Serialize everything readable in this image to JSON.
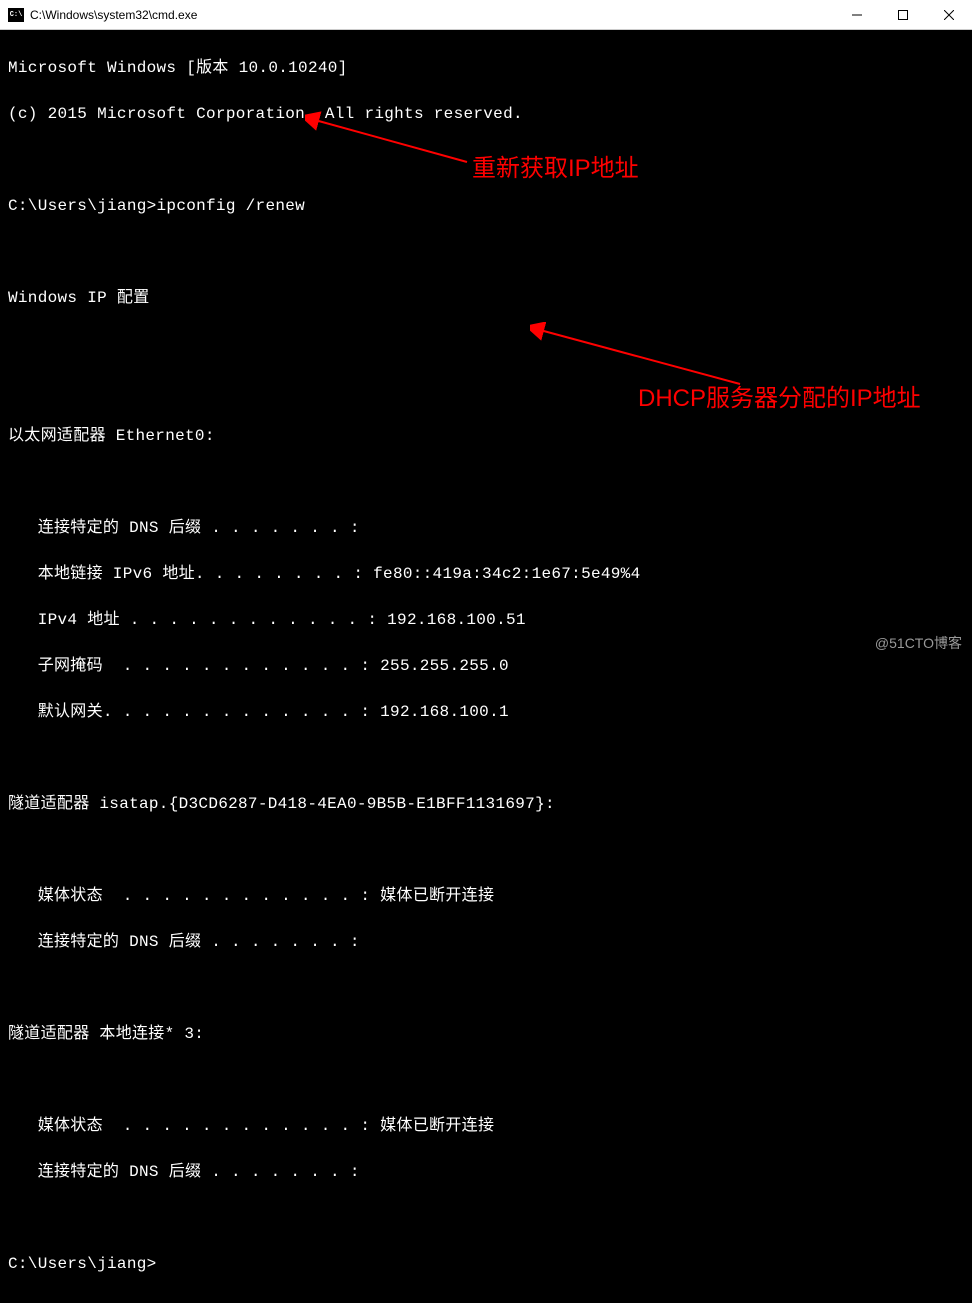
{
  "window": {
    "title": "C:\\Windows\\system32\\cmd.exe"
  },
  "terminal": {
    "line1": "Microsoft Windows [版本 10.0.10240]",
    "line2": "(c) 2015 Microsoft Corporation. All rights reserved.",
    "blank1": "",
    "prompt1": "C:\\Users\\jiang>ipconfig /renew",
    "blank2": "",
    "header1": "Windows IP 配置",
    "blank3": "",
    "blank4": "",
    "adapter1_title": "以太网适配器 Ethernet0:",
    "blank5": "",
    "adapter1_dns": "   连接特定的 DNS 后缀 . . . . . . . :",
    "adapter1_ipv6": "   本地链接 IPv6 地址. . . . . . . . : fe80::419a:34c2:1e67:5e49%4",
    "adapter1_ipv4": "   IPv4 地址 . . . . . . . . . . . . : 192.168.100.51",
    "adapter1_mask": "   子网掩码  . . . . . . . . . . . . : 255.255.255.0",
    "adapter1_gw": "   默认网关. . . . . . . . . . . . . : 192.168.100.1",
    "blank6": "",
    "adapter2_title": "隧道适配器 isatap.{D3CD6287-D418-4EA0-9B5B-E1BFF1131697}:",
    "blank7": "",
    "adapter2_media": "   媒体状态  . . . . . . . . . . . . : 媒体已断开连接",
    "adapter2_dns": "   连接特定的 DNS 后缀 . . . . . . . :",
    "blank8": "",
    "adapter3_title": "隧道适配器 本地连接* 3:",
    "blank9": "",
    "adapter3_media": "   媒体状态  . . . . . . . . . . . . : 媒体已断开连接",
    "adapter3_dns": "   连接特定的 DNS 后缀 . . . . . . . :",
    "blank10": "",
    "prompt2": "C:\\Users\\jiang>"
  },
  "annotations": {
    "a1": "重新获取IP地址",
    "a2": "DHCP服务器分配的IP地址"
  },
  "watermark": "@51CTO博客"
}
